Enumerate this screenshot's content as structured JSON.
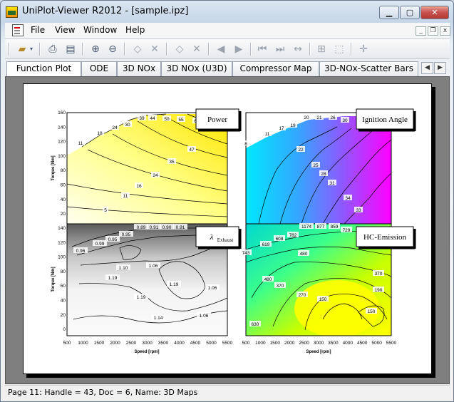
{
  "window": {
    "title": "UniPlot-Viewer R2012 - [sample.ipz]"
  },
  "menu": {
    "items": [
      "File",
      "View",
      "Window",
      "Help"
    ]
  },
  "tabs": [
    "Function Plot",
    "ODE",
    "3D NOx",
    "3D NOx (U3D)",
    "Compressor Map",
    "3D-NOx-Scatter Bars"
  ],
  "toolbar": {
    "icons": [
      "open-icon",
      "print-icon",
      "print-preview-icon",
      "zoom-in-icon",
      "zoom-out-icon",
      "rotate-left-icon",
      "rotate-right-icon",
      "flip-up-icon",
      "flip-down-icon",
      "previous-icon",
      "next-icon",
      "first-icon",
      "last-icon",
      "fit-width-icon",
      "grid-icon",
      "crop-icon",
      "crosshair-icon"
    ]
  },
  "status": {
    "text": "Page 11: Handle = 43, Doc = 6, Name: 3D Maps"
  },
  "chart_data": [
    {
      "type": "heatmap",
      "title": "Power",
      "xlabel": "",
      "ylabel": "Torque [Nm]",
      "xlim": [
        500,
        5500
      ],
      "ylim": [
        0,
        160
      ],
      "contour_labels": [
        "5",
        "11",
        "16",
        "24",
        "35",
        "47",
        "11",
        "18",
        "24",
        "30",
        "39",
        "44",
        "50",
        "55",
        "66"
      ]
    },
    {
      "type": "heatmap",
      "title": "Ignition Angle",
      "xlabel": "",
      "ylabel": "",
      "xlim": [
        500,
        5500
      ],
      "ylim": [
        0,
        160
      ],
      "contour_labels": [
        "8",
        "11",
        "17",
        "19",
        "20",
        "21",
        "26",
        "30",
        "22",
        "25",
        "28",
        "31",
        "34",
        "33"
      ]
    },
    {
      "type": "heatmap",
      "title_main": "λ",
      "title_sub": "Exhaust",
      "xlabel": "Speed [rpm]",
      "ylabel": "Torque [Nm]",
      "xlim": [
        500,
        5500
      ],
      "ylim": [
        0,
        160
      ],
      "contour_labels": [
        "0.96",
        "0.99",
        "0.95",
        "0.95",
        "0.89",
        "0.91",
        "0.90",
        "0.91",
        "1.10",
        "1.06",
        "1.19",
        "1.19",
        "1.19",
        "1.06",
        "1.14",
        "1.06"
      ]
    },
    {
      "type": "heatmap",
      "title": "HC-Emission",
      "xlabel": "Speed [rpm]",
      "ylabel": "",
      "xlim": [
        500,
        5500
      ],
      "ylim": [
        0,
        160
      ],
      "contour_labels": [
        "743",
        "619",
        "608",
        "782",
        "1174",
        "877",
        "859",
        "729",
        "480",
        "480",
        "370",
        "370",
        "270",
        "190",
        "150",
        "150",
        "630"
      ]
    }
  ],
  "axes": {
    "y_ticks": [
      "160",
      "140",
      "120",
      "100",
      "80",
      "60",
      "40",
      "20"
    ],
    "y_ticks_bottom": [
      "140",
      "120",
      "100",
      "80",
      "60",
      "40",
      "20",
      "0"
    ],
    "x_ticks": [
      "500",
      "1000",
      "1500",
      "2000",
      "2500",
      "3000",
      "3500",
      "4000",
      "4500",
      "5000",
      "5500"
    ]
  }
}
